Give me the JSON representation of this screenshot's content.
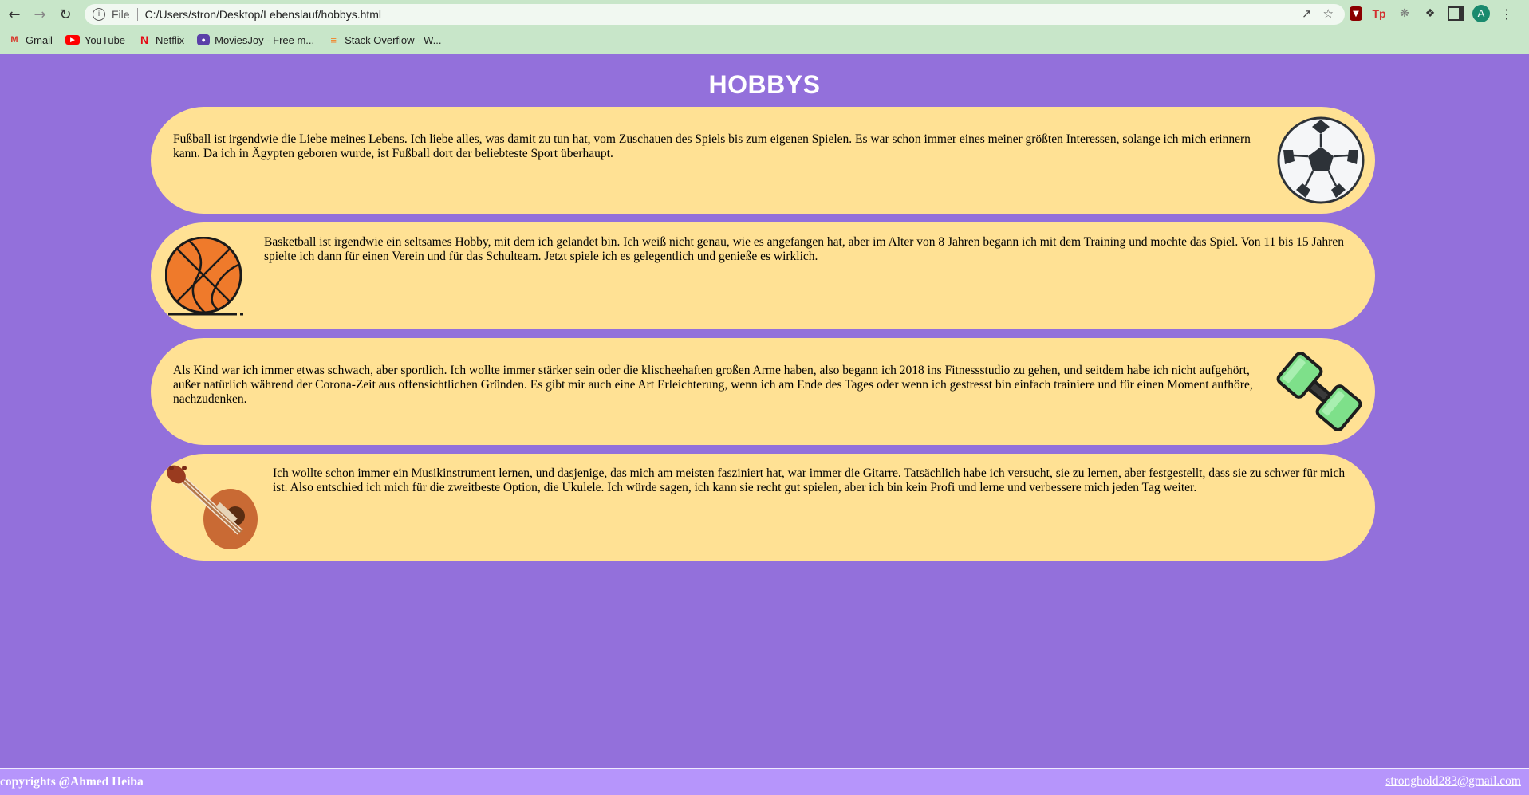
{
  "browser": {
    "scheme_label": "File",
    "url": "C:/Users/stron/Desktop/Lebenslauf/hobbys.html",
    "avatar_letter": "A",
    "extension_tp": "Tp",
    "bookmarks": [
      {
        "label": "Gmail",
        "icon": "gmail-icon"
      },
      {
        "label": "YouTube",
        "icon": "youtube-icon"
      },
      {
        "label": "Netflix",
        "icon": "netflix-icon"
      },
      {
        "label": "MoviesJoy - Free m...",
        "icon": "moviesjoy-icon"
      },
      {
        "label": "Stack Overflow - W...",
        "icon": "stackoverflow-icon"
      }
    ]
  },
  "page": {
    "title": "HOBBYS",
    "background": "#9370DB",
    "card_color": "#ffe194",
    "hobbies": [
      {
        "name": "football",
        "icon": "soccer-ball-icon",
        "text": "Fußball ist irgendwie die Liebe meines Lebens. Ich liebe alles, was damit zu tun hat, vom Zuschauen des Spiels bis zum eigenen Spielen. Es war schon immer eines meiner größten Interessen, solange ich mich erinnern kann. Da ich in Ägypten geboren wurde, ist Fußball dort der beliebteste Sport überhaupt."
      },
      {
        "name": "basketball",
        "icon": "basketball-icon",
        "text": "Basketball ist irgendwie ein seltsames Hobby, mit dem ich gelandet bin. Ich weiß nicht genau, wie es angefangen hat, aber im Alter von 8 Jahren begann ich mit dem Training und mochte das Spiel. Von 11 bis 15 Jahren spielte ich dann für einen Verein und für das Schulteam. Jetzt spiele ich es gelegentlich und genieße es wirklich."
      },
      {
        "name": "fitness",
        "icon": "dumbbell-icon",
        "text": "Als Kind war ich immer etwas schwach, aber sportlich. Ich wollte immer stärker sein oder die klischeehaften großen Arme haben, also begann ich 2018 ins Fitnessstudio zu gehen, und seitdem habe ich nicht aufgehört, außer natürlich während der Corona-Zeit aus offensichtlichen Gründen. Es gibt mir auch eine Art Erleichterung, wenn ich am Ende des Tages oder wenn ich gestresst bin einfach trainiere und für einen Moment aufhöre, nachzudenken."
      },
      {
        "name": "ukulele",
        "icon": "ukulele-icon",
        "text": "Ich wollte schon immer ein Musikinstrument lernen, und dasjenige, das mich am meisten fasziniert hat, war immer die Gitarre. Tatsächlich habe ich versucht, sie zu lernen, aber festgestellt, dass sie zu schwer für mich ist. Also entschied ich mich für die zweitbeste Option, die Ukulele. Ich würde sagen, ich kann sie recht gut spielen, aber ich bin kein Profi und lerne und verbessere mich jeden Tag weiter."
      }
    ]
  },
  "footer": {
    "copyright": "copyrights @Ahmed Heiba",
    "email": "stronghold283@gmail.com"
  }
}
